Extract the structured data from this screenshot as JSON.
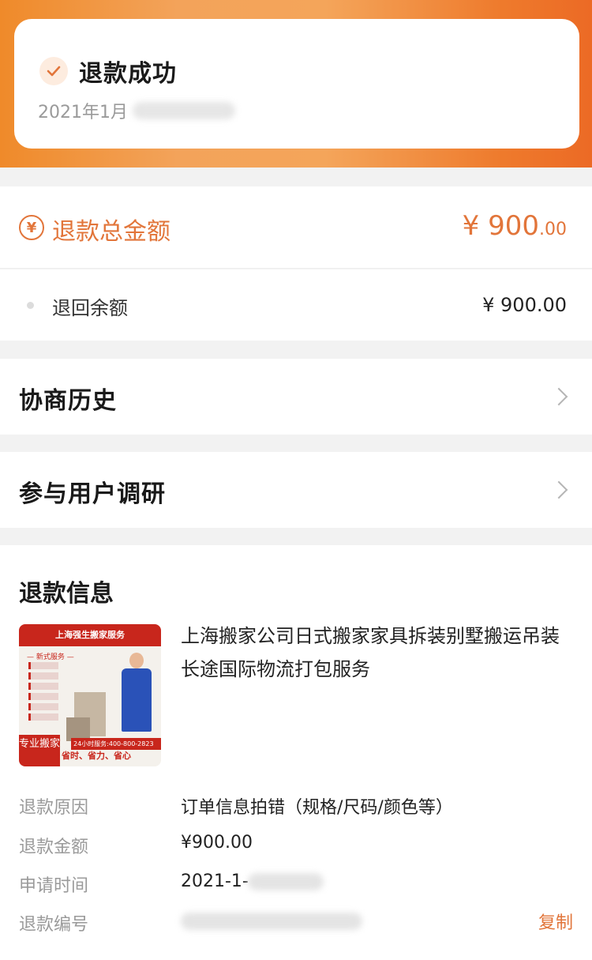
{
  "status": {
    "title": "退款成功",
    "time": "2021年1月",
    "icon": "check-icon",
    "accent_color": "#e2753a"
  },
  "refund_total": {
    "label": "退款总金额",
    "currency_symbol": "¥",
    "amount_int": "900",
    "amount_dec": ".00",
    "icon": "yen-circle-icon"
  },
  "refund_balance": {
    "label": "退回余额",
    "amount": "¥ 900.00"
  },
  "nav": {
    "history": "协商历史",
    "survey": "参与用户调研"
  },
  "refund_info": {
    "title": "退款信息",
    "product": {
      "title": "上海搬家公司日式搬家家具拆装别墅搬运吊装长途国际物流打包服务",
      "image": {
        "banner": "上海强生搬家服务",
        "services_header": "— 新式服务 —",
        "hotline": "24小时服务:400-800-2823",
        "badge": "专业搬家",
        "slogan": "省时、省力、省心"
      }
    },
    "fields": {
      "reason_label": "退款原因",
      "reason_value": "订单信息拍错（规格/尺码/颜色等）",
      "amount_label": "退款金额",
      "amount_value": "¥900.00",
      "time_label": "申请时间",
      "time_value": "2021-1-",
      "number_label": "退款编号",
      "copy_label": "复制"
    }
  }
}
